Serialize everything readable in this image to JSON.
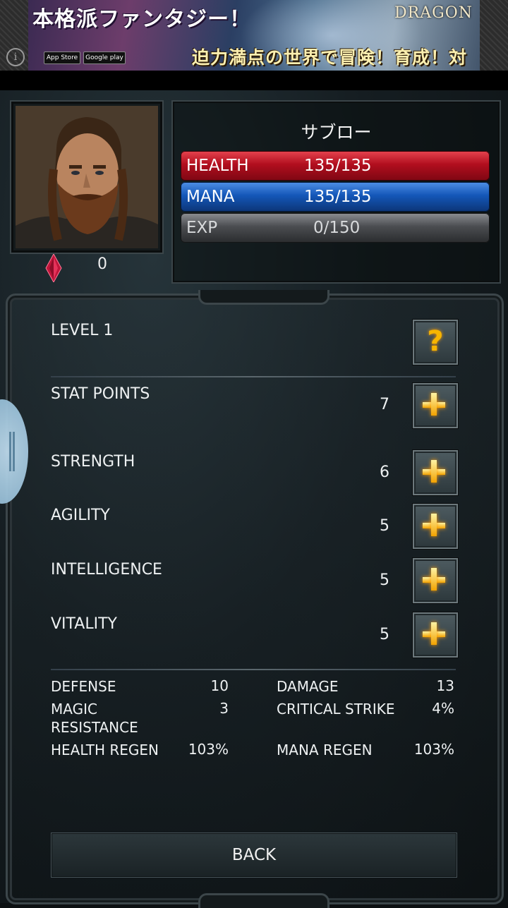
{
  "ad": {
    "headline": "本格派ファンタジー！",
    "logo": "DRAGON",
    "tagline": "迫力満点の世界で冒険！育成！対戦！",
    "store_1": "App Store",
    "store_2": "Google play",
    "info_glyph": "i"
  },
  "character": {
    "name": "サブロー",
    "gems": "0",
    "health_label": "HEALTH",
    "health_value": "135/135",
    "mana_label": "MANA",
    "mana_value": "135/135",
    "exp_label": "EXP",
    "exp_value": "0/150"
  },
  "level": {
    "label": "LEVEL 1",
    "help_glyph": "?"
  },
  "stats": {
    "stat_points": {
      "label": "STAT POINTS",
      "value": "7"
    },
    "strength": {
      "label": "STRENGTH",
      "value": "6"
    },
    "agility": {
      "label": "AGILITY",
      "value": "5"
    },
    "intelligence": {
      "label": "INTELLIGENCE",
      "value": "5"
    },
    "vitality": {
      "label": "VITALITY",
      "value": "5"
    }
  },
  "derived": {
    "defense": {
      "label": "DEFENSE",
      "value": "10"
    },
    "damage": {
      "label": "DAMAGE",
      "value": "13"
    },
    "magic_resistance": {
      "label": "MAGIC RESISTANCE",
      "value": "3"
    },
    "critical_strike": {
      "label": "CRITICAL STRIKE",
      "value": "4%"
    },
    "health_regen": {
      "label": "HEALTH REGEN",
      "value": "103%"
    },
    "mana_regen": {
      "label": "MANA REGEN",
      "value": "103%"
    }
  },
  "back_label": "BACK",
  "colors": {
    "health": "#b10e1e",
    "mana": "#1457b8",
    "exp": "#4b4d51",
    "accent_plus": "#f2a200",
    "gem": "#c0153a"
  },
  "icons": [
    "info-icon",
    "gem-icon",
    "help-icon",
    "plus-icon"
  ]
}
